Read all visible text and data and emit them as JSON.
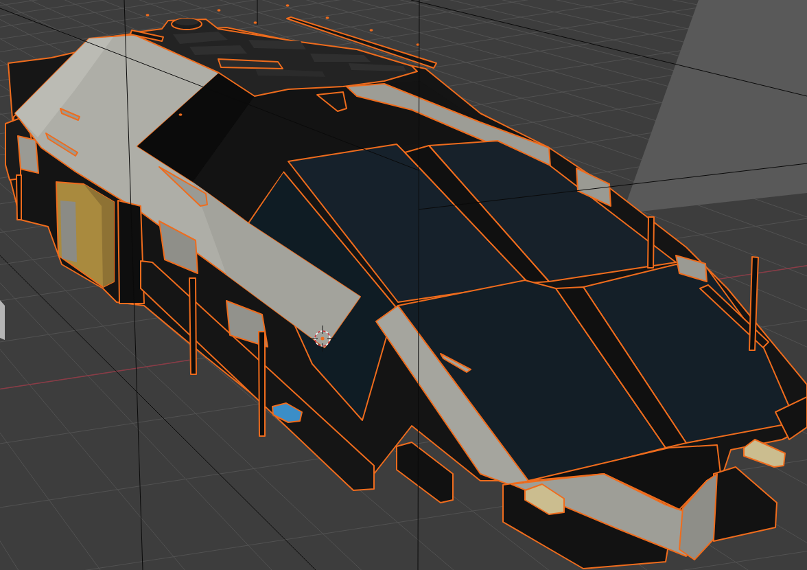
{
  "viewport": {
    "model": {
      "selected": true
    }
  }
}
